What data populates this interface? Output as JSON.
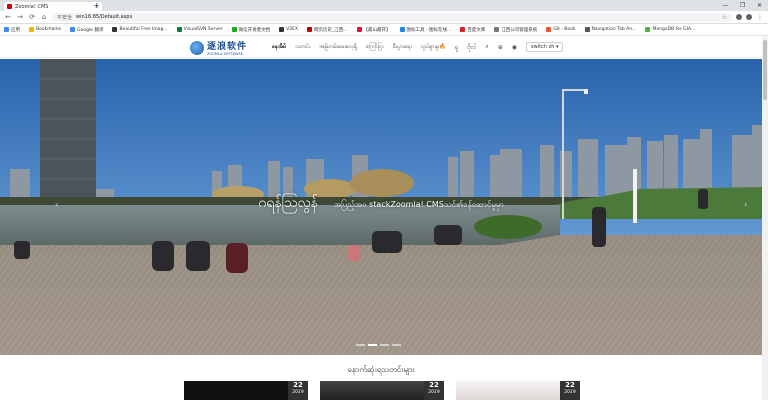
{
  "browser": {
    "tab_title": "Zoomla! CMS",
    "new_tab": "+",
    "tab_close": "×",
    "secure_label": "不安全",
    "url": "win16:85/Default.aspx",
    "star": "☆",
    "window_controls": [
      "—",
      "❐",
      "✕"
    ],
    "nav": {
      "back": "←",
      "forward": "→",
      "reload": "⟳",
      "home": "⌂"
    }
  },
  "bookmarks": [
    {
      "label": "应用",
      "color": "#4285f4"
    },
    {
      "label": "Bookmarks",
      "color": "#f4b400"
    },
    {
      "label": "Google 翻译",
      "color": "#4285f4"
    },
    {
      "label": "Beautiful Free Imag...",
      "color": "#333333"
    },
    {
      "label": "VisualSVN Server",
      "color": "#0b7a3e"
    },
    {
      "label": "微信开发者文档",
      "color": "#1aad19"
    },
    {
      "label": "V2EX",
      "color": "#333333"
    },
    {
      "label": "网页历史_江西...",
      "color": "#c00000"
    },
    {
      "label": "【最山最开】",
      "color": "#d14"
    },
    {
      "label": "图标工具 - 图标在线...",
      "color": "#1e88e5"
    },
    {
      "label": "百度文库",
      "color": "#d22"
    },
    {
      "label": "江西公司管理系统",
      "color": "#777777"
    },
    {
      "label": "Git - Book",
      "color": "#f05033"
    },
    {
      "label": "Navigation Tab An...",
      "color": "#555555"
    },
    {
      "label": "MongoDB for GIA...",
      "color": "#4db33d"
    }
  ],
  "site": {
    "logo_text": "逐浪软件",
    "logo_sub": "ZOOMLA SOFTWARE",
    "menu": [
      {
        "label": "နေအိမ်",
        "active": true
      },
      {
        "label": "သတင်း",
        "active": false
      },
      {
        "label": "အမြဲတမ်းမေးလေ့ရှိ",
        "active": false
      },
      {
        "label": "ကြော်ငြာ",
        "active": false
      },
      {
        "label": "စီးပွားရေး",
        "active": false
      },
      {
        "label": "လှုပ်ရှားမှု",
        "active": false
      }
    ],
    "hot_icon": "🔥",
    "icons": {
      "extra": "ရှ",
      "extra2": "ဗိုလ်",
      "search": "⌕",
      "globe": "⊕",
      "user": "◉"
    },
    "switch_label": "switch zh ▾"
  },
  "hero": {
    "caption_big": "ဂရန်သြလွန်",
    "caption_small": "အပြည့်အဝ stackZoomla!  CMSသင်၏ဝန်ဆောင်မှုမှာ",
    "prev": "‹",
    "next": "›",
    "slides": 4,
    "active_slide": 1
  },
  "latest": {
    "title": "နောက်ဆုံးရသတင်းများ",
    "cards": [
      {
        "day": "22",
        "year": "2019"
      },
      {
        "day": "22",
        "year": "2019"
      },
      {
        "day": "22",
        "year": "2019"
      }
    ]
  },
  "colors": {
    "brand": "#1a4c8f",
    "sky": "#2f6fb8",
    "deck": "#9a8f82"
  }
}
